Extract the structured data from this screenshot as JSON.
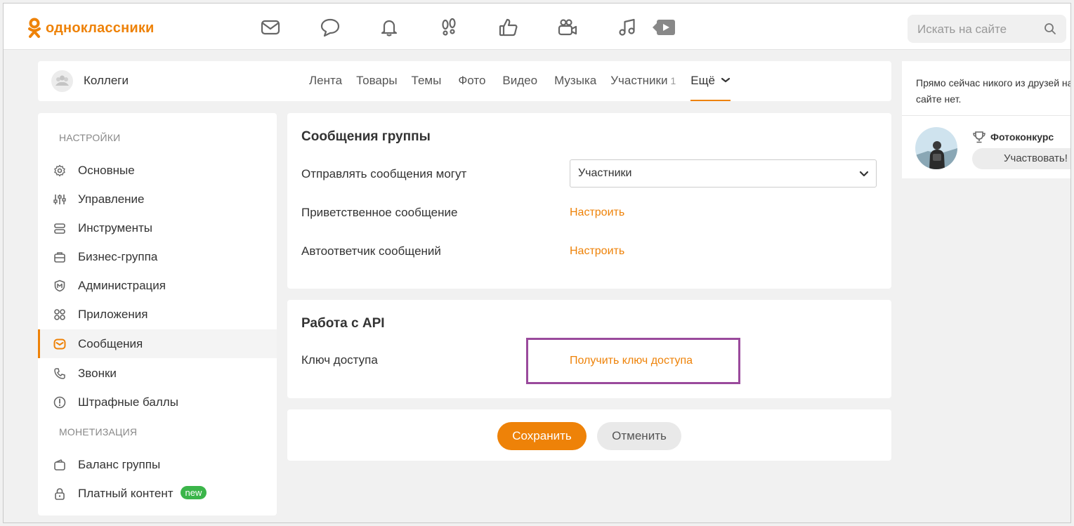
{
  "brand": {
    "logo_text": "одноклассники",
    "accent": "#ee8208"
  },
  "topnav": {
    "icons": [
      "mail-icon",
      "chat-icon",
      "bell-icon",
      "footprints-icon",
      "like-icon",
      "video-camera-icon",
      "music-icon",
      "play-icon"
    ],
    "search_placeholder": "Искать на сайте"
  },
  "group": {
    "name": "Коллеги",
    "tabs": [
      {
        "label": "Лента"
      },
      {
        "label": "Товары"
      },
      {
        "label": "Темы"
      },
      {
        "label": "Фото"
      },
      {
        "label": "Видео"
      },
      {
        "label": "Музыка"
      },
      {
        "label": "Участники",
        "count": "1"
      },
      {
        "label": "Ещё"
      }
    ]
  },
  "sidebar": {
    "section_settings": "НАСТРОЙКИ",
    "items": [
      {
        "label": "Основные",
        "icon": "gear-icon"
      },
      {
        "label": "Управление",
        "icon": "sliders-icon"
      },
      {
        "label": "Инструменты",
        "icon": "tools-icon"
      },
      {
        "label": "Бизнес-группа",
        "icon": "briefcase-icon"
      },
      {
        "label": "Администрация",
        "icon": "moderator-icon"
      },
      {
        "label": "Приложения",
        "icon": "apps-icon"
      },
      {
        "label": "Сообщения",
        "icon": "mail-icon"
      },
      {
        "label": "Звонки",
        "icon": "phone-icon"
      },
      {
        "label": "Штрафные баллы",
        "icon": "warning-icon"
      }
    ],
    "section_monetization": "МОНЕТИЗАЦИЯ",
    "monetization_items": [
      {
        "label": "Баланс группы",
        "icon": "wallet-icon"
      },
      {
        "label": "Платный контент",
        "icon": "lock-icon",
        "badge": "new"
      }
    ]
  },
  "messages_panel": {
    "title": "Сообщения группы",
    "who_can_send_label": "Отправлять сообщения могут",
    "who_can_send_value": "Участники",
    "welcome_label": "Приветственное сообщение",
    "welcome_link": "Настроить",
    "autoreply_label": "Автоответчик сообщений",
    "autoreply_link": "Настроить"
  },
  "api_panel": {
    "title": "Работа с API",
    "key_label": "Ключ доступа",
    "key_link": "Получить ключ доступа"
  },
  "actions": {
    "save": "Сохранить",
    "cancel": "Отменить"
  },
  "right": {
    "friends_online": "Прямо сейчас никого из друзей на сайте нет.",
    "contest_title": "Фотоконкурс",
    "contest_button": "Участвовать!"
  },
  "colors": {
    "accent": "#ee8208",
    "highlight": "#9a4a9c",
    "badge_new": "#3bb54a"
  }
}
